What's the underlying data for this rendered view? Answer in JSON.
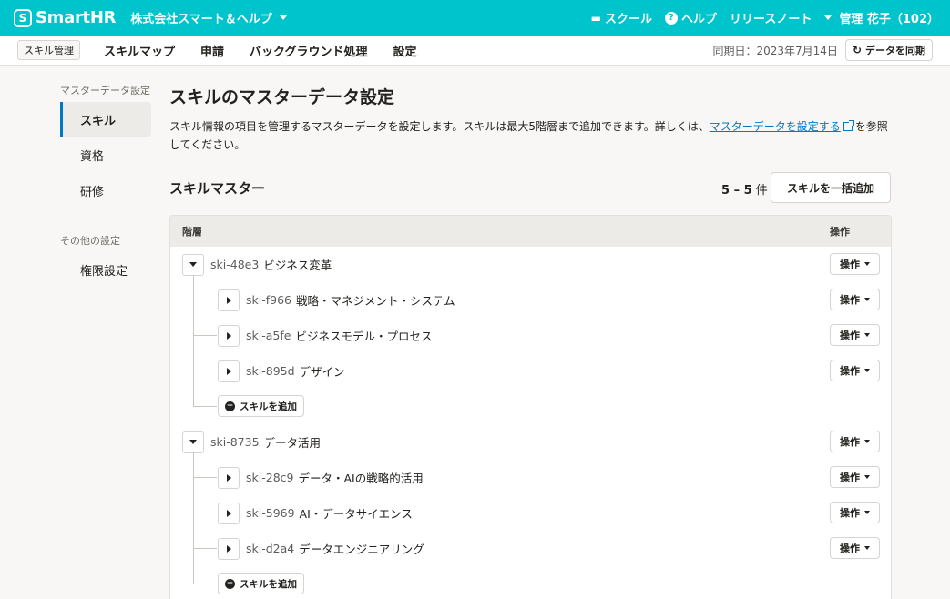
{
  "header": {
    "logo_mark": "S",
    "logo_text": "SmartHR",
    "tenant": "株式会社スマート＆ヘルプ",
    "school": "スクール",
    "help": "ヘルプ",
    "release_notes": "リリースノート",
    "user": "管理 花子（102）"
  },
  "appbar": {
    "app_name": "スキル管理",
    "nav": [
      "スキルマップ",
      "申請",
      "バックグラウンド処理",
      "設定"
    ],
    "sync_date": "同期日：2023年7月14日",
    "sync_button": "データを同期"
  },
  "sidebar": {
    "caption_master": "マスターデータ設定",
    "items": [
      "スキル",
      "資格",
      "研修"
    ],
    "caption_other": "その他の設定",
    "other_items": [
      "権限設定"
    ]
  },
  "main": {
    "title": "スキルのマスターデータ設定",
    "desc_text": "スキル情報の項目を管理するマスターデータを設定します。スキルは最大5階層まで追加できます。詳しくは、",
    "desc_link": "マスターデータを設定する",
    "desc_tail": "を参照してください。",
    "section_title": "スキルマスター",
    "count_range": "5 – 5",
    "count_unit": "件",
    "bulk_add": "スキルを一括追加",
    "table_head_hierarchy": "階層",
    "table_head_actions": "操作",
    "op_label": "操作",
    "add_skill_label": "スキルを追加"
  },
  "skills": [
    {
      "id": "ski-48e3",
      "name": "ビジネス変革",
      "children": [
        {
          "id": "ski-f966",
          "name": "戦略・マネジメント・システム"
        },
        {
          "id": "ski-a5fe",
          "name": "ビジネスモデル・プロセス"
        },
        {
          "id": "ski-895d",
          "name": "デザイン"
        }
      ]
    },
    {
      "id": "ski-8735",
      "name": "データ活用",
      "children": [
        {
          "id": "ski-28c9",
          "name": "データ・AIの戦略的活用"
        },
        {
          "id": "ski-5969",
          "name": "AI・データサイエンス"
        },
        {
          "id": "ski-d2a4",
          "name": "データエンジニアリング"
        }
      ]
    }
  ],
  "colors": {
    "brand": "#00c4cc",
    "link": "#0077c7"
  }
}
